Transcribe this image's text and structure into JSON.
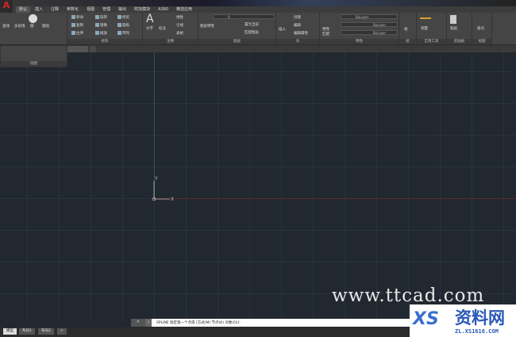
{
  "app": {
    "logo": "A"
  },
  "tabs": [
    "默认",
    "插入",
    "注释",
    "参数化",
    "视图",
    "管理",
    "输出",
    "附加模块",
    "A360",
    "精选应用"
  ],
  "ribbon": {
    "draw": {
      "title": "绘图",
      "items": [
        "直线",
        "多段线",
        "圆",
        "圆弧"
      ]
    },
    "modify": {
      "title": "修改",
      "items": [
        "移动",
        "旋转",
        "修剪",
        "复制",
        "镜像",
        "圆角",
        "拉伸",
        "缩放",
        "阵列"
      ]
    },
    "annotation": {
      "title": "注释",
      "items": [
        "文字",
        "标注",
        "线性",
        "引线",
        "表格"
      ]
    },
    "layers": {
      "title": "图层",
      "items": [
        "图层特性",
        "置为当前",
        "匹配图层"
      ],
      "layer_value": "0"
    },
    "block": {
      "title": "块",
      "items": [
        "插入",
        "创建",
        "编辑",
        "编辑属性"
      ]
    },
    "properties": {
      "title": "特性",
      "items": [
        "特性匹配"
      ],
      "color": "ByLayer",
      "linetype": "ByLayer",
      "lineweight": "ByLayer"
    },
    "groups": {
      "title": "组",
      "items": [
        "组"
      ]
    },
    "utilities": {
      "title": "实用工具",
      "items": [
        "测量"
      ]
    },
    "clipboard": {
      "title": "剪贴板",
      "items": [
        "粘贴"
      ]
    },
    "view": {
      "title": "视图",
      "items": [
        "基点"
      ]
    }
  },
  "ucs": {
    "x": "X",
    "y": "Y"
  },
  "command": {
    "text": "SPLINE 指定第一个点或 [方式(M) 节点(K) 对象(O)]:"
  },
  "layouts": [
    "模型",
    "布局1",
    "布局2",
    "+"
  ],
  "watermark": {
    "site": "www.ttcad.com",
    "logo_text": "XS",
    "brand": "资料网",
    "url": "ZL.XS1616.COM"
  },
  "colors": {
    "canvas": "#212830",
    "x_axis": "#5a2a2a",
    "y_axis": "#2e5a34",
    "logo": "#dd2222"
  }
}
